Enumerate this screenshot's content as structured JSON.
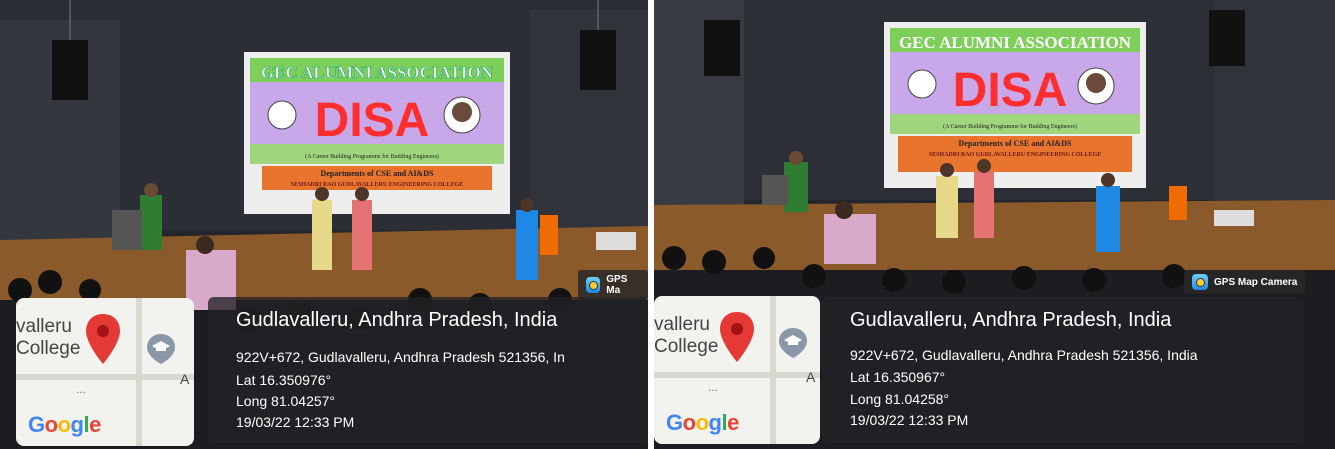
{
  "screen": {
    "banner_line1": "GEC ALUMNI ASSOCIATION",
    "banner_title": "DISA",
    "banner_sub": "(A Career Building Programme for Budding Engineers)",
    "banner_dept": "Departments of CSE and AI&DS",
    "banner_college": "SESHADRI RAO GUDLAVALLERU ENGINEERING COLLEGE"
  },
  "gps_left": {
    "tag": "GPS Ma",
    "place": "Gudlavalleru, Andhra Pradesh, India",
    "address": "922V+672, Gudlavalleru, Andhra Pradesh 521356, In",
    "lat": "Lat 16.350976°",
    "long": "Long 81.04257°",
    "datetime": "19/03/22 12:33 PM",
    "map_label": "valleru\nCollege",
    "map_side": "A"
  },
  "gps_right": {
    "tag": "GPS Map Camera",
    "place": "Gudlavalleru, Andhra Pradesh, India",
    "address": "922V+672, Gudlavalleru, Andhra Pradesh 521356, India",
    "lat": "Lat 16.350967°",
    "long": "Long 81.04258°",
    "datetime": "19/03/22 12:33 PM",
    "map_label": "valleru\nCollege",
    "map_side": "A"
  },
  "map_brand": "Google",
  "colors": {
    "banner_green": "#8fd36a",
    "banner_purple": "#c8a6e8",
    "pin_red": "#e53935",
    "hall_dark": "#1c1f24",
    "stage_wood": "#8a5a2b"
  }
}
